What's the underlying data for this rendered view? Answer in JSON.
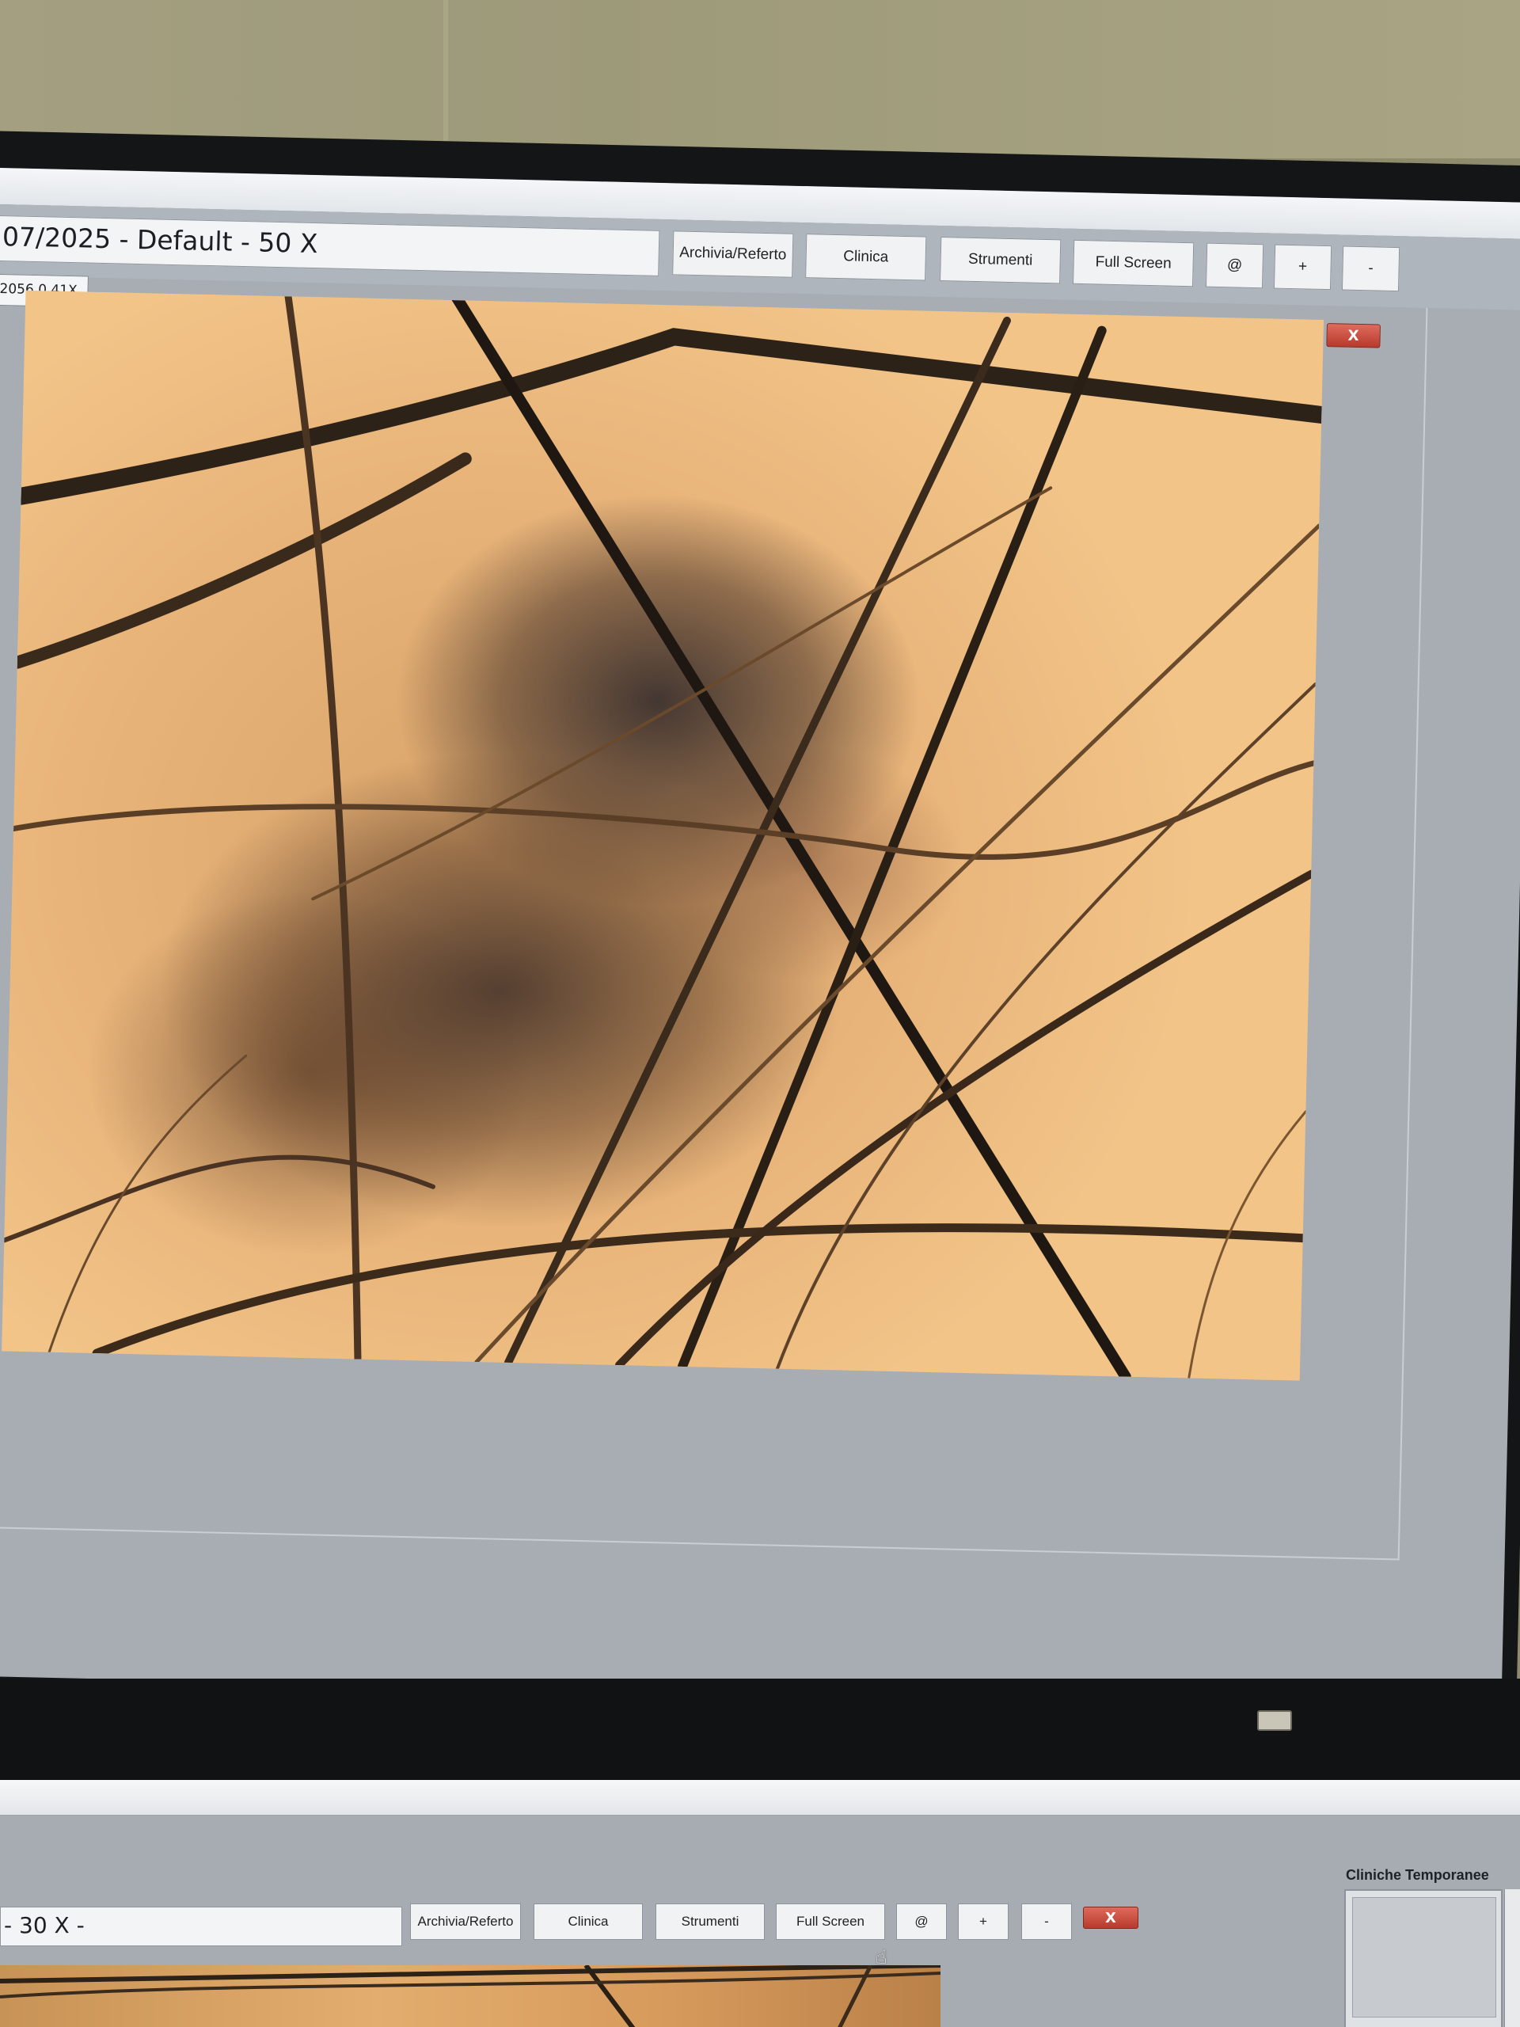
{
  "upper_window": {
    "title": "07/2025 - Default - 50 X",
    "zoom_label": "2056 0.41X",
    "buttons": {
      "archivia": "Archivia/Referto",
      "clinica": "Clinica",
      "strumenti": "Strumenti",
      "fullscreen": "Full Screen",
      "at": "@",
      "plus": "+",
      "minus": "-"
    },
    "close_label": "X"
  },
  "lower_window": {
    "title": "- 30 X -",
    "buttons": {
      "archivia": "Archivia/Referto",
      "clinica": "Clinica",
      "strumenti": "Strumenti",
      "fullscreen": "Full Screen",
      "at": "@",
      "plus": "+",
      "minus": "-"
    },
    "close_label": "X",
    "side_panel_title": "Cliniche Temporanee"
  },
  "colors": {
    "close_button": "#c8493a",
    "window_background": "#a7adb3",
    "button_face": "#f1f2f3"
  },
  "icons": {
    "close": "close-icon",
    "cursor": "hand-pointer-icon"
  }
}
